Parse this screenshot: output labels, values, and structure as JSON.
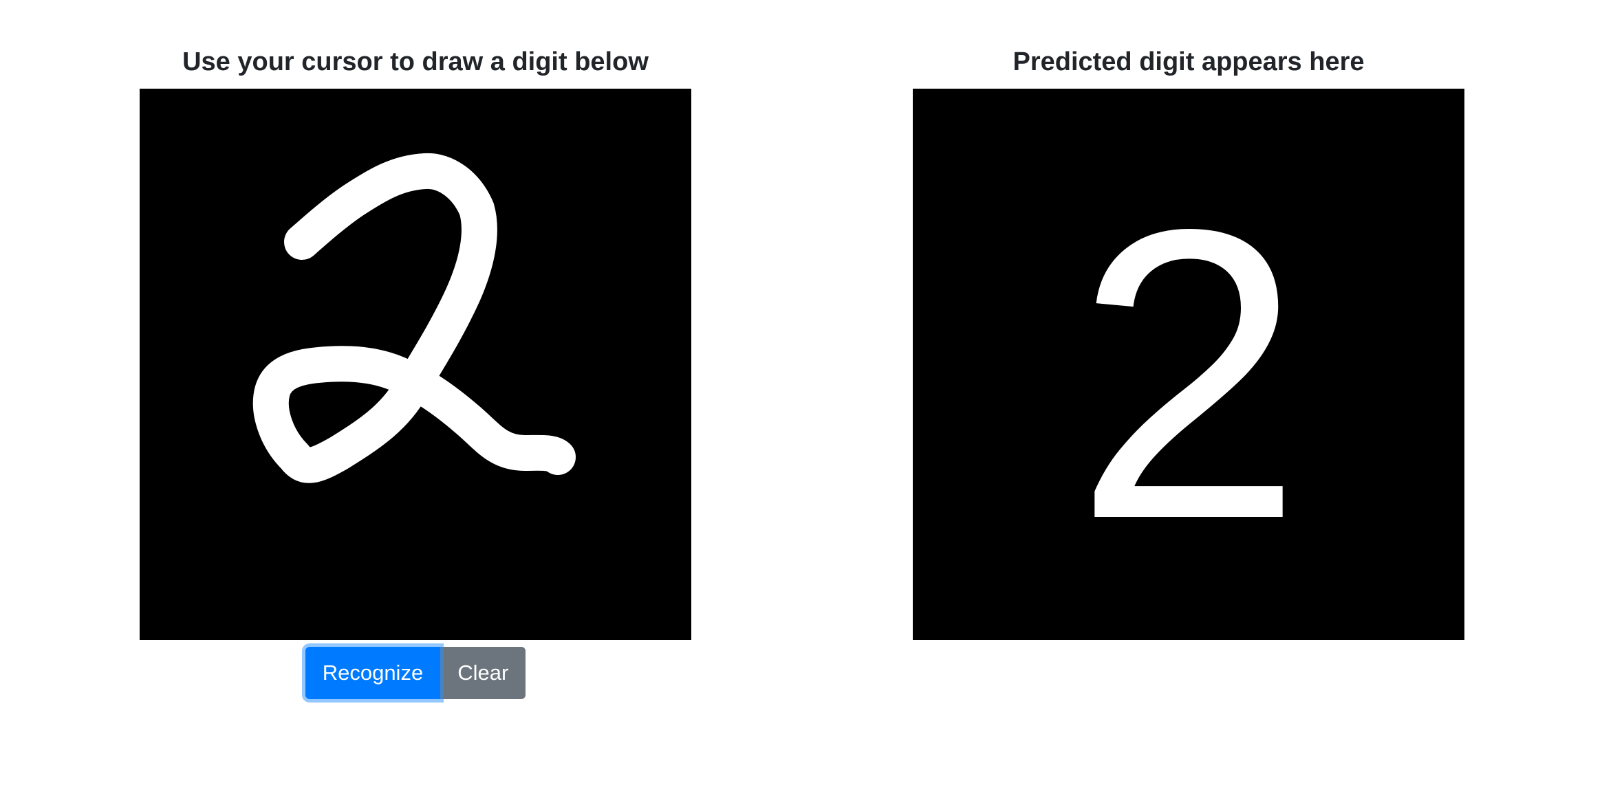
{
  "draw_panel": {
    "title": "Use your cursor to draw a digit below",
    "canvas_background": "#000000",
    "stroke_color": "#ffffff"
  },
  "prediction_panel": {
    "title": "Predicted digit appears here",
    "predicted_digit": "2",
    "background": "#000000",
    "digit_color": "#ffffff"
  },
  "buttons": {
    "recognize_label": "Recognize",
    "clear_label": "Clear",
    "primary_color": "#007bff",
    "secondary_color": "#6c757d"
  }
}
